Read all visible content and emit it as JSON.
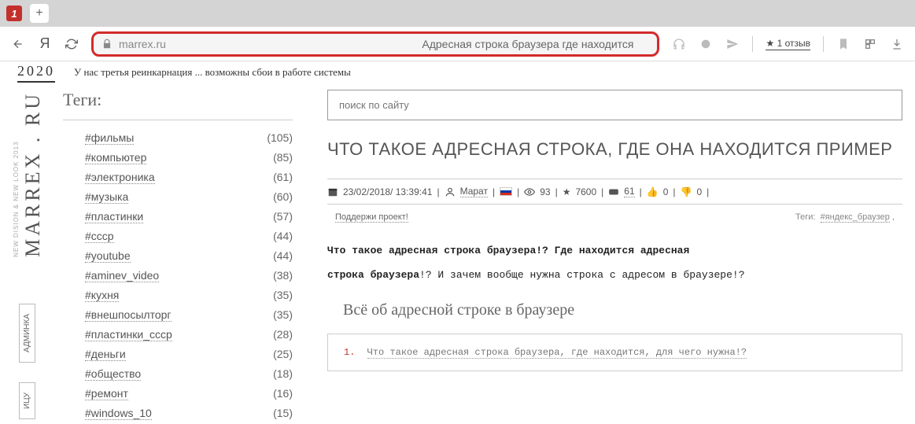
{
  "browser": {
    "url": "marrex.ru",
    "address_hint": "Адресная строка браузера где находится",
    "reviews": "1 отзыв",
    "newtab": "+"
  },
  "banner": {
    "year": "2020",
    "text": "У нас третья реинкарнация ... возможны сбои в работе системы"
  },
  "logo": {
    "main": "MARREX . RU",
    "sub": "NEW DISION & NEW LOOK 2013"
  },
  "side_tabs": {
    "t1": "АДМИНКА",
    "t2": "ИЦУ"
  },
  "sidebar": {
    "title": "Теги:",
    "tags": [
      {
        "label": "#фильмы",
        "count": "(105)"
      },
      {
        "label": "#компьютер",
        "count": "(85)"
      },
      {
        "label": "#электроника",
        "count": "(61)"
      },
      {
        "label": "#музыка",
        "count": "(60)"
      },
      {
        "label": "#пластинки",
        "count": "(57)"
      },
      {
        "label": "#ссср",
        "count": "(44)"
      },
      {
        "label": "#youtube",
        "count": "(44)"
      },
      {
        "label": "#aminev_video",
        "count": "(38)"
      },
      {
        "label": "#кухня",
        "count": "(35)"
      },
      {
        "label": "#внешпосылторг",
        "count": "(35)"
      },
      {
        "label": "#пластинки_ссср",
        "count": "(28)"
      },
      {
        "label": "#деньги",
        "count": "(25)"
      },
      {
        "label": "#общество",
        "count": "(18)"
      },
      {
        "label": "#ремонт",
        "count": "(16)"
      },
      {
        "label": "#windows_10",
        "count": "(15)"
      }
    ]
  },
  "main": {
    "search_placeholder": "поиск по сайту",
    "title": "ЧТО ТАКОЕ АДРЕСНАЯ СТРОКА, ГДЕ ОНА НАХОДИТСЯ ПРИМЕР",
    "meta": {
      "date": "23/02/2018/ 13:39:41",
      "author": "Марат",
      "views": "93",
      "stars": "7600",
      "yt": "61",
      "up": "0",
      "down": "0"
    },
    "support": "Поддержи проект!",
    "tags_label": "Теги:",
    "tag1": "#яндекс_браузер",
    "p1a": "Что такое адресная строка браузера!? Где находится адресная",
    "p1b": "строка браузера",
    "p1c": "!? И зачем вообще нужна строка с адресом в браузере!?",
    "sec_title": "Всё об адресной строке в браузере",
    "toc1_num": "1.",
    "toc1": "Что такое адресная строка браузера, где находится, для чего нужна!?"
  }
}
